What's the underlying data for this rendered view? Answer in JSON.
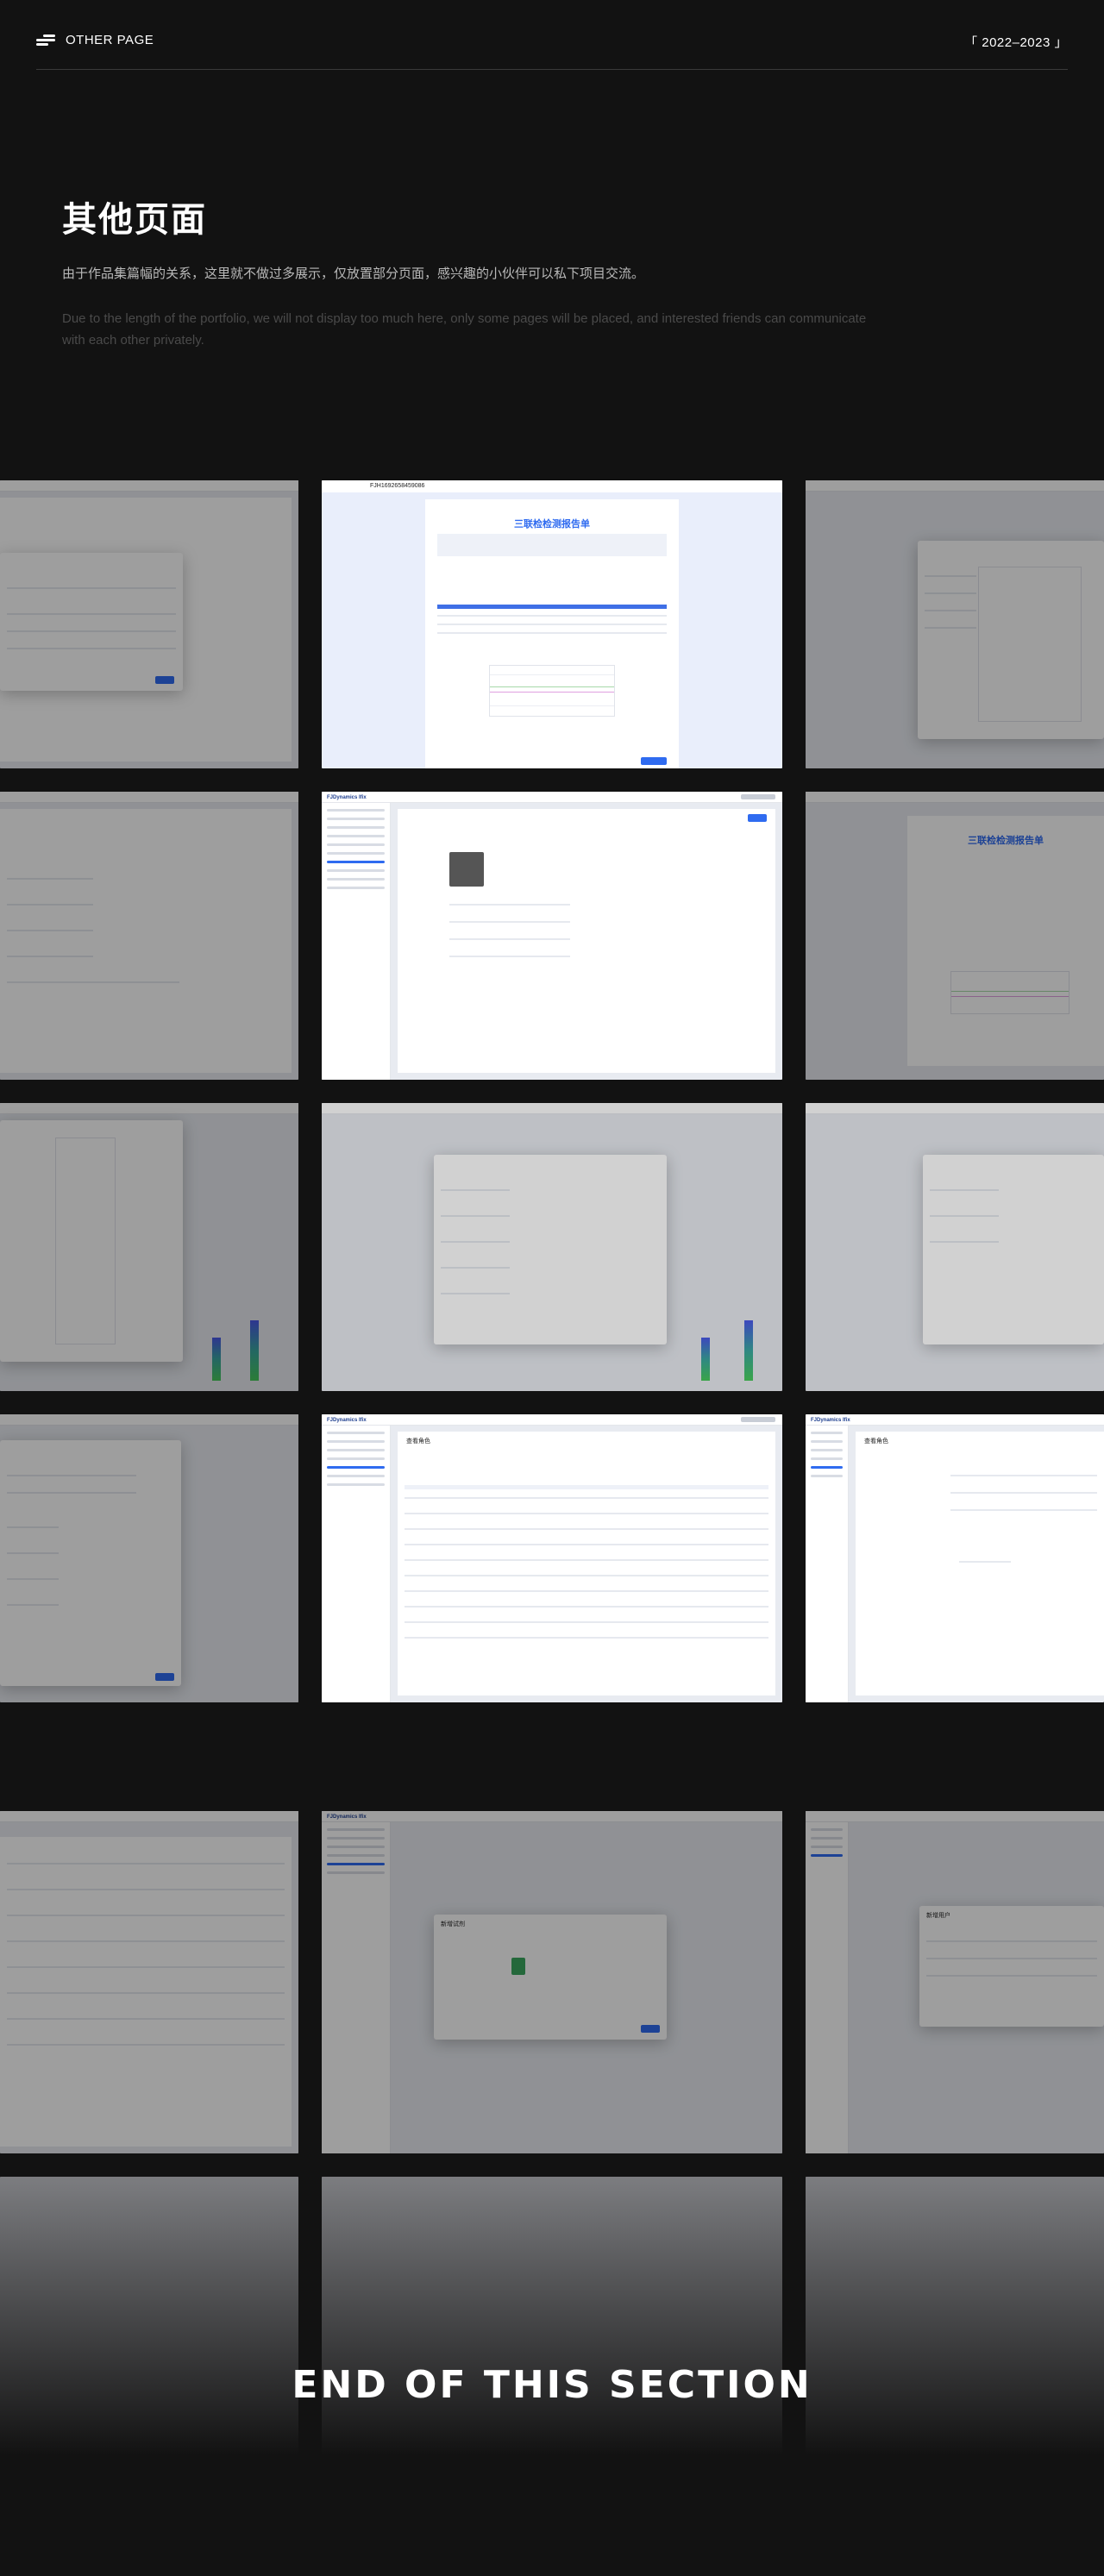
{
  "header": {
    "brand_label": "OTHER PAGE",
    "year_label": "「 2022–2023 」"
  },
  "intro": {
    "title": "其他页面",
    "description_cn": "由于作品集篇幅的关系，这里就不做过多展示，仅放置部分页面，感兴趣的小伙伴可以私下项目交流。",
    "description_en": "Due to the length of the portfolio, we will not display too much here, only some pages will be placed, and interested friends can communicate with each other privately."
  },
  "screenshots": {
    "report_id": "FJH1692658459086",
    "report_title": "三联检检测报告单",
    "app_logo": "FJDynamics Ifix",
    "role_title": "查看角色",
    "add_user_title": "新增用户",
    "add_test_title": "新增试剂"
  },
  "end_label": "END OF THIS SECTION"
}
